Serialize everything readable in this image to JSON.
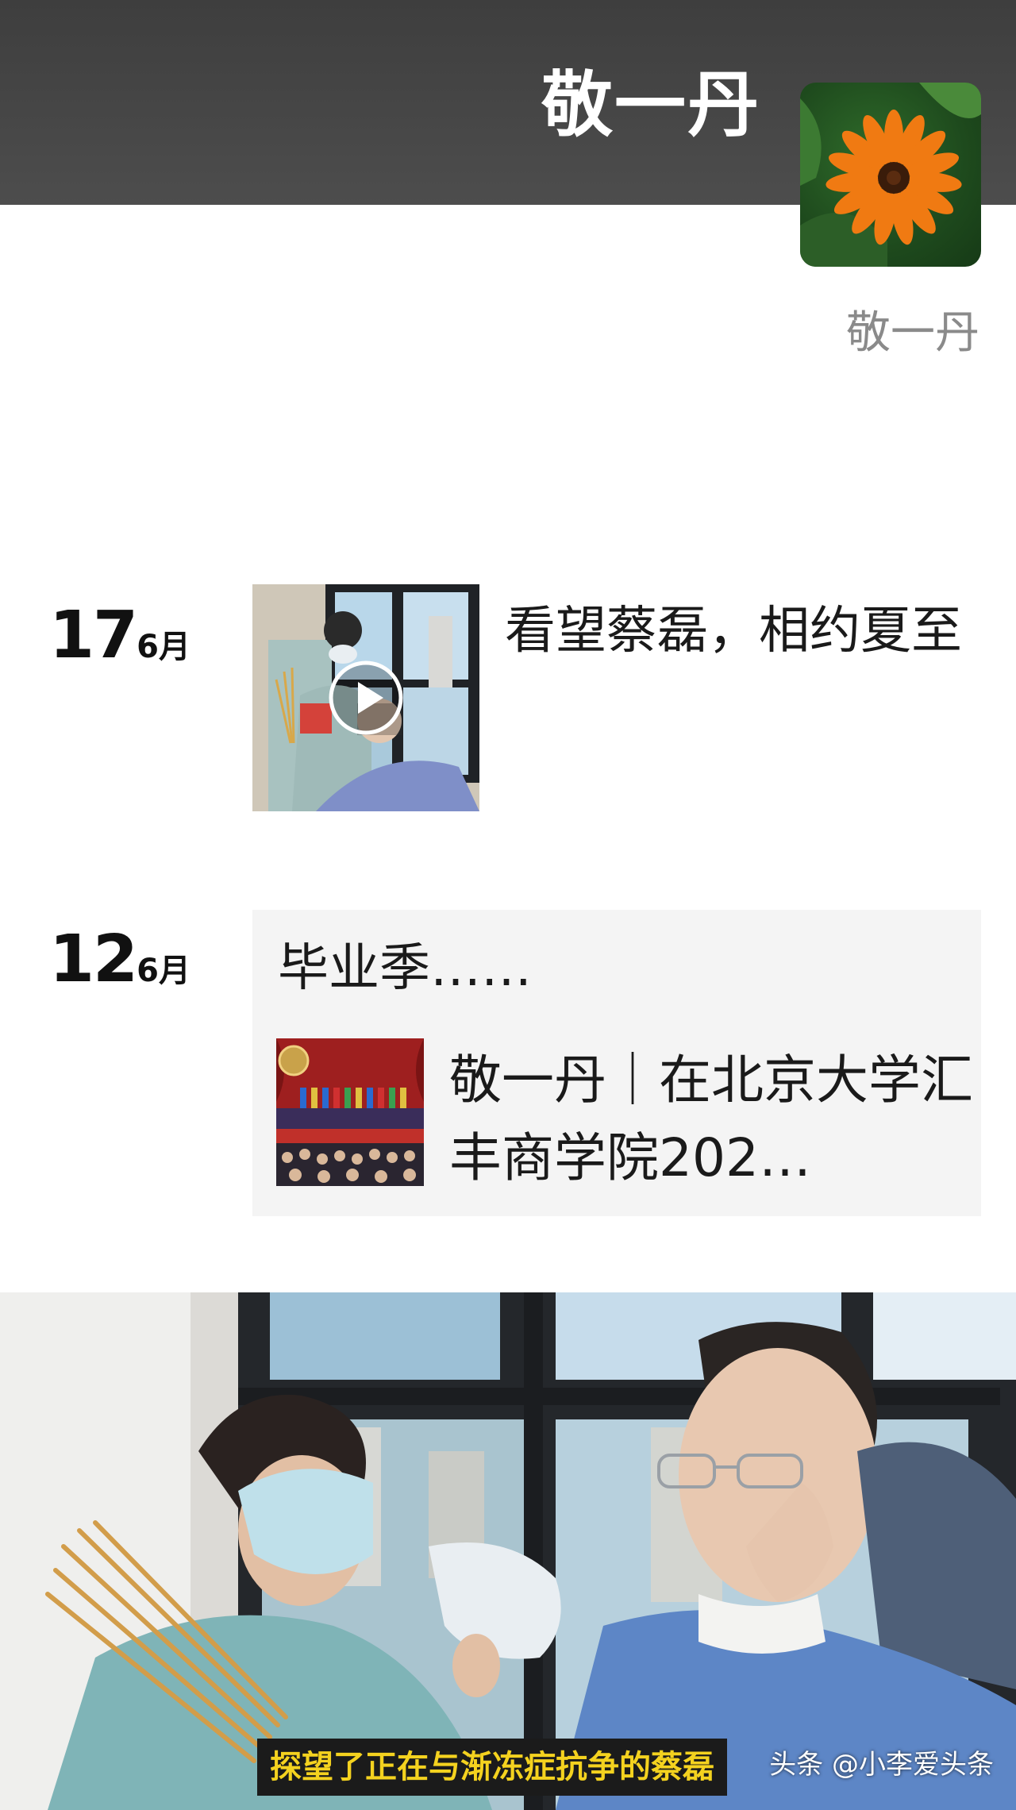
{
  "header": {
    "name": "敬一丹",
    "avatar_icon": "orange-flower-avatar"
  },
  "profile": {
    "display_name": "敬一丹"
  },
  "posts": [
    {
      "day": "17",
      "month": "6月",
      "type": "video",
      "text": "看望蔡磊，相约夏至",
      "thumbnail_icon": "play-icon"
    },
    {
      "day": "12",
      "month": "6月",
      "type": "link",
      "caption": "毕业季……",
      "link_title": "敬一丹｜在北京大学汇丰商学院202…"
    }
  ],
  "video_frame": {
    "subtitle": "探望了正在与渐冻症抗争的蔡磊",
    "watermark": "头条 @小李爱头条"
  },
  "colors": {
    "header_bg": "#464646",
    "subtitle_text": "#f4d21f",
    "link_card_bg": "#f4f4f4"
  }
}
